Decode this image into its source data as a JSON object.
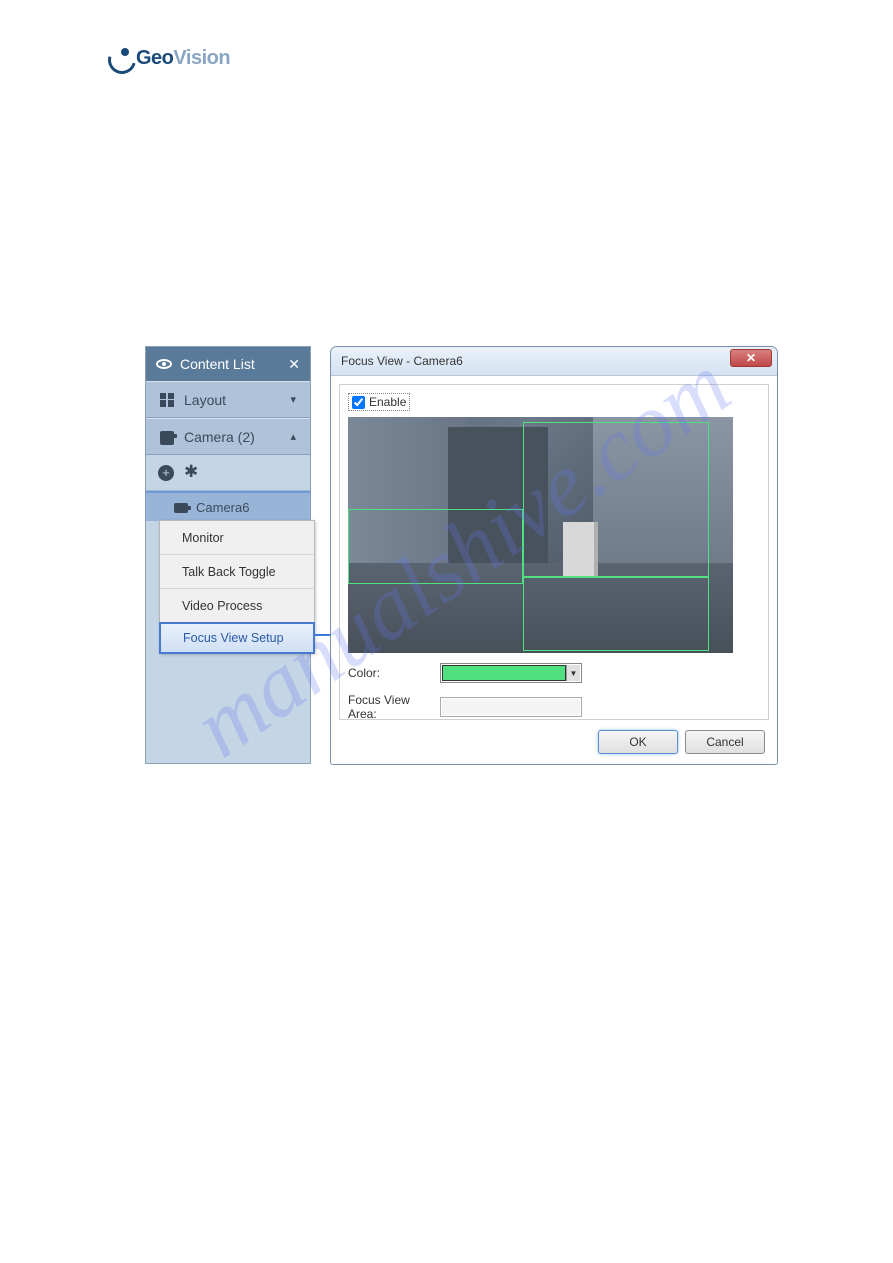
{
  "brand": {
    "name_part1": "Geo",
    "name_part2": "Vision"
  },
  "content_list": {
    "title": "Content List",
    "sections": {
      "layout": {
        "label": "Layout"
      },
      "camera": {
        "label": "Camera (2)"
      }
    },
    "camera_item": "Camera6"
  },
  "context_menu": {
    "items": [
      {
        "label": "Monitor"
      },
      {
        "label": "Talk Back Toggle"
      },
      {
        "label": "Video Process"
      },
      {
        "label": "Focus View Setup",
        "selected": true
      }
    ]
  },
  "dialog": {
    "title": "Focus View - Camera6",
    "enable_label": "Enable",
    "color_label": "Color:",
    "color_value": "#50e080",
    "focus_view_area_label": "Focus View Area:",
    "focus_view_area_value": "",
    "ok": "OK",
    "cancel": "Cancel"
  },
  "watermark": "manualshive.com"
}
